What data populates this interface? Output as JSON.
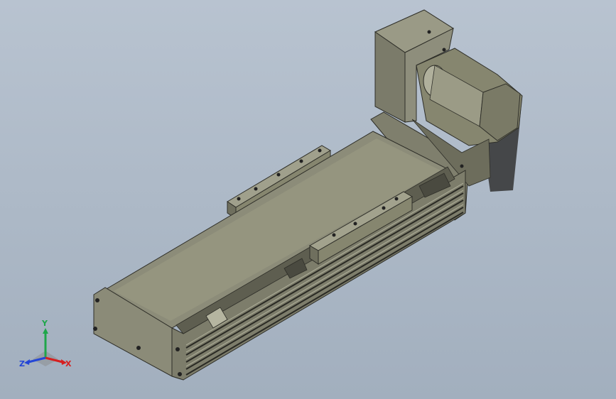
{
  "viewport": {
    "background_top": "#b8c3d0",
    "background_bottom": "#a2afbe"
  },
  "model": {
    "body_color": "#8a8a78",
    "dark_color": "#3e3e36",
    "light_color": "#a9a996"
  },
  "triad": {
    "y_label": "Y",
    "x_label": "X",
    "z_label": "Z",
    "y_color": "#1fa64a",
    "x_color": "#d61f1f",
    "z_color": "#2446d6"
  }
}
